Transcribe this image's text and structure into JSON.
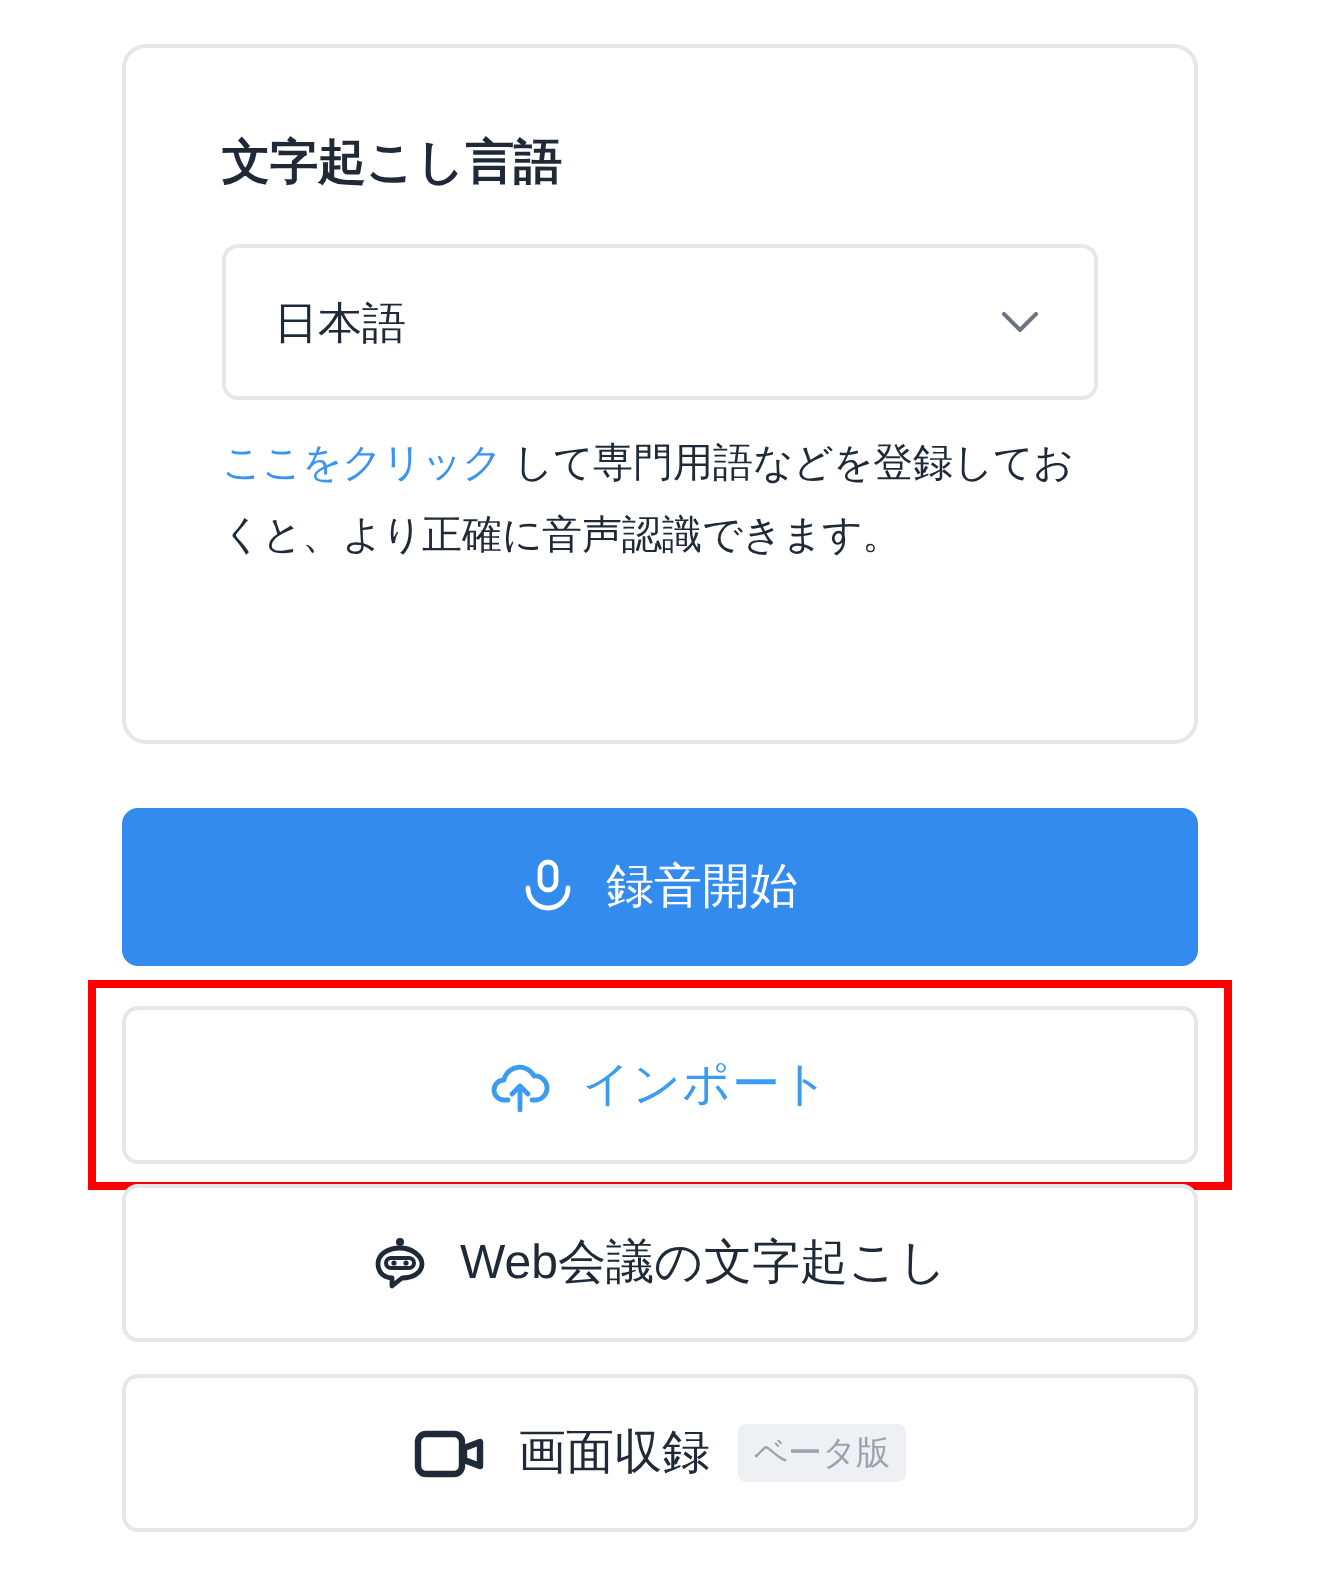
{
  "language_card": {
    "title": "文字起こし言語",
    "select": {
      "value": "日本語"
    },
    "help": {
      "link": "ここをクリック",
      "text": " して専門用語などを登録しておくと、より正確に音声認識できます。"
    }
  },
  "actions": [
    {
      "kind": "primary",
      "label": "録音開始",
      "highlighted": false
    },
    {
      "kind": "accent",
      "label": "インポート",
      "highlighted": true
    },
    {
      "kind": "plain",
      "label": "Web会議の文字起こし",
      "highlighted": false
    },
    {
      "kind": "plain",
      "label": "画面収録",
      "badge": "ベータ版",
      "highlighted": false
    }
  ]
}
